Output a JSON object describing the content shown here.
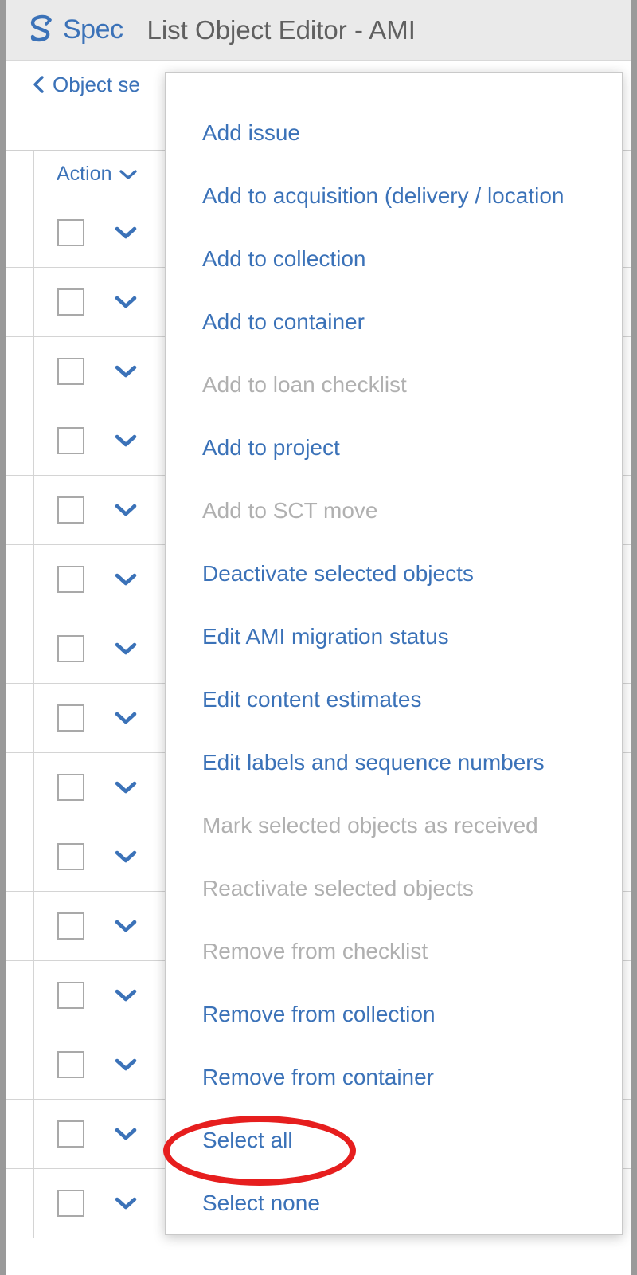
{
  "header": {
    "logo_icon": "spec-s-arrow-logo-icon",
    "brand": "Spec",
    "title": "List Object Editor - AMI"
  },
  "breadcrumb": {
    "back_icon": "chevron-left-icon",
    "label": "Object se"
  },
  "table": {
    "columns": [
      {
        "label": "Action",
        "caret_icon": "chevron-down-icon"
      }
    ],
    "row_checkbox_name": "row-select-checkbox",
    "row_caret_icon": "chevron-down-icon",
    "row_count": 15
  },
  "action_menu": {
    "pointer_icon": "menu-caret-left-icon",
    "items": [
      {
        "label": "Add issue",
        "disabled": false
      },
      {
        "label": "Add to acquisition (delivery / location",
        "disabled": false
      },
      {
        "label": "Add to collection",
        "disabled": false
      },
      {
        "label": "Add to container",
        "disabled": false
      },
      {
        "label": "Add to loan checklist",
        "disabled": true
      },
      {
        "label": "Add to project",
        "disabled": false
      },
      {
        "label": "Add to SCT move",
        "disabled": true
      },
      {
        "label": "Deactivate selected objects",
        "disabled": false
      },
      {
        "label": "Edit AMI migration status",
        "disabled": false
      },
      {
        "label": "Edit content estimates",
        "disabled": false
      },
      {
        "label": "Edit labels and sequence numbers",
        "disabled": false
      },
      {
        "label": "Mark selected objects as received",
        "disabled": true
      },
      {
        "label": "Reactivate selected objects",
        "disabled": true
      },
      {
        "label": "Remove from checklist",
        "disabled": true
      },
      {
        "label": "Remove from collection",
        "disabled": false
      },
      {
        "label": "Remove from container",
        "disabled": false
      },
      {
        "label": "Select all",
        "disabled": false
      },
      {
        "label": "Select none",
        "disabled": false
      }
    ]
  },
  "annotation": {
    "name": "select-all-highlight-ellipse",
    "color": "#e61e1e",
    "target": "Select all"
  },
  "colors": {
    "link_blue": "#3b72b8",
    "disabled_gray": "#b0b0b0",
    "header_bg": "#eaeaea",
    "title_gray": "#606060",
    "annotation_red": "#e61e1e",
    "page_frame_gray": "#9a9a9a"
  }
}
